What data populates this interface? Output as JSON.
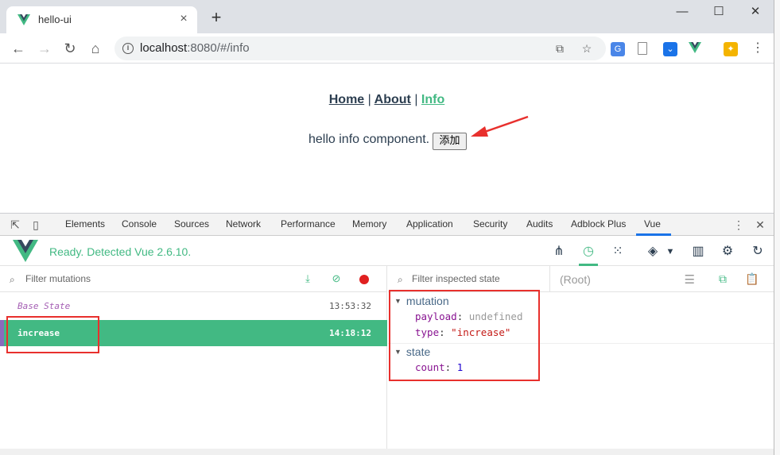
{
  "browser": {
    "tab_title": "hello-ui",
    "tab_close": "×",
    "new_tab": "+",
    "url_host": "localhost",
    "url_path": ":8080/#/info",
    "window_minimize": "—",
    "window_maximize": "☐",
    "window_close": "✕"
  },
  "page": {
    "nav": {
      "home": "Home",
      "about": "About",
      "info": "Info",
      "sep": "|"
    },
    "info_text": "hello info component.",
    "add_button": "添加"
  },
  "devtools": {
    "tabs": [
      "Elements",
      "Console",
      "Sources",
      "Network",
      "Performance",
      "Memory",
      "Application",
      "Security",
      "Audits",
      "Adblock Plus",
      "Vue"
    ],
    "active_tab": "Vue",
    "vue": {
      "ready_text": "Ready. Detected Vue 2.6.10.",
      "filter_mutations_placeholder": "Filter mutations",
      "filter_state_placeholder": "Filter inspected state",
      "root_select": "(Root)",
      "mutations": [
        {
          "name": "Base State",
          "time": "13:53:32"
        },
        {
          "name": "increase",
          "time": "14:18:12"
        }
      ],
      "inspected": {
        "mutation_title": "mutation",
        "payload_key": "payload",
        "payload_val": "undefined",
        "type_key": "type",
        "type_val": "\"increase\"",
        "state_title": "state",
        "count_key": "count",
        "count_val": "1"
      }
    }
  },
  "colors": {
    "vue_green": "#42b983",
    "vue_dark": "#35495e",
    "annotation_red": "#e8302d"
  }
}
